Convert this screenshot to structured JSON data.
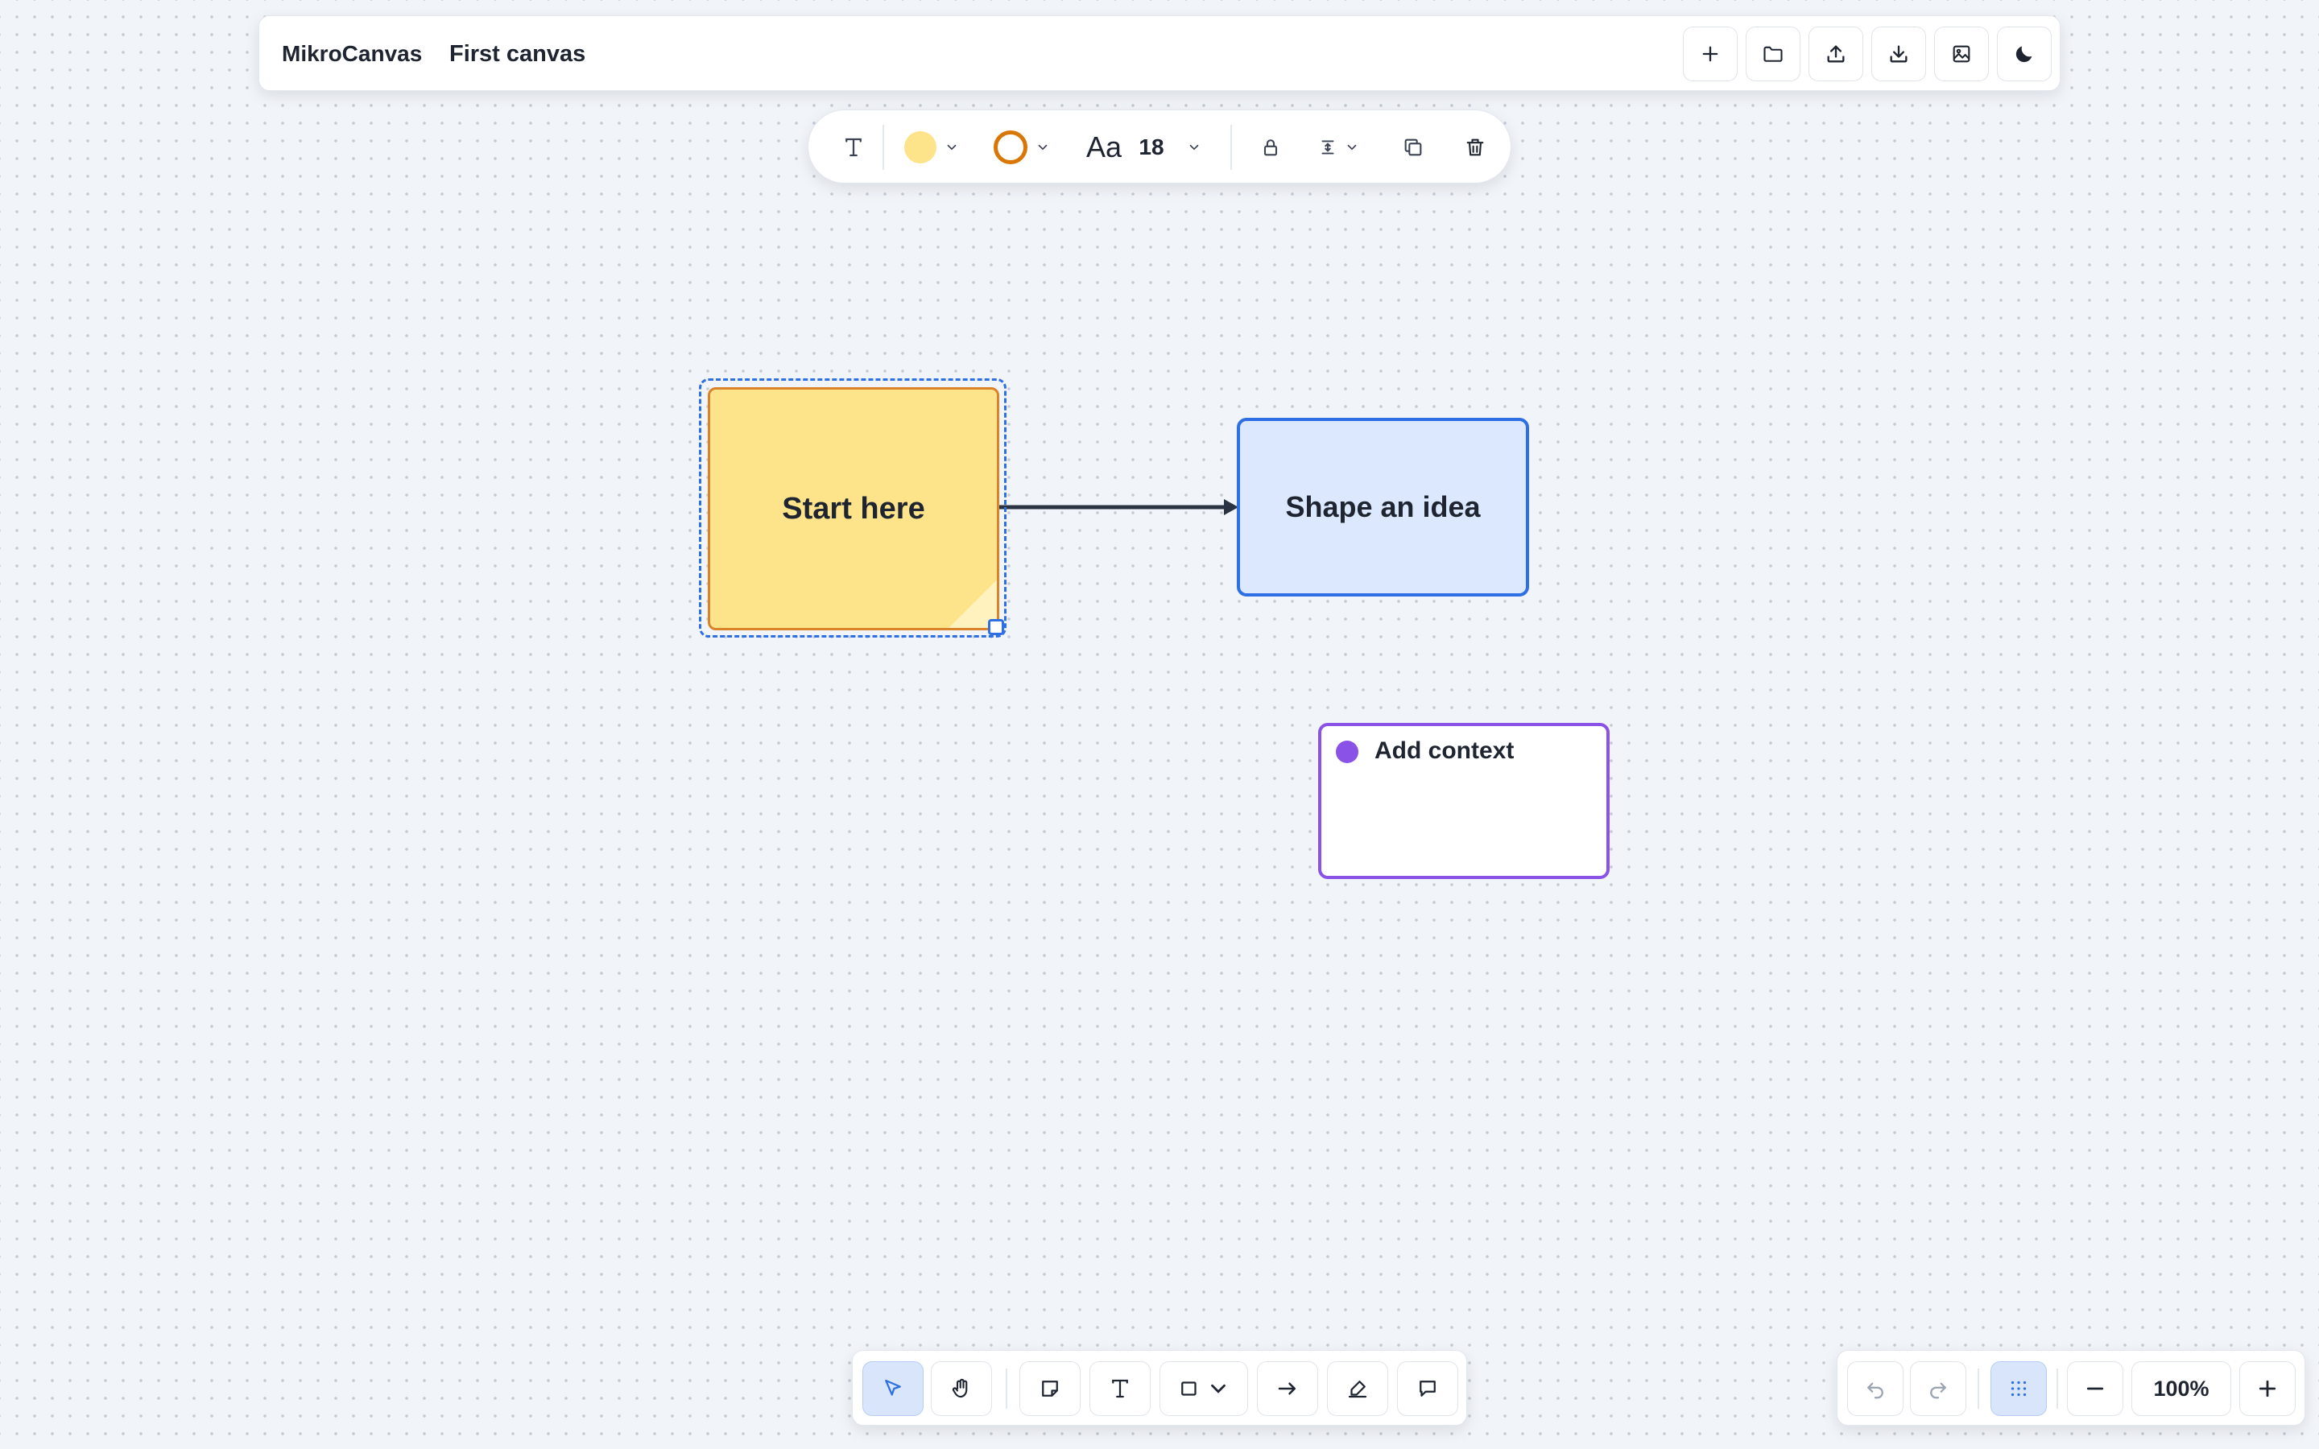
{
  "header": {
    "app_name": "MikroCanvas",
    "canvas_name": "First canvas",
    "buttons": [
      "new-canvas",
      "open-folder",
      "upload",
      "download",
      "export-image",
      "dark-mode"
    ]
  },
  "format_bar": {
    "text_tool": "text-style",
    "fill_color": "#fde38a",
    "stroke_color": "#d97706",
    "font_label": "Aa",
    "font_size": "18"
  },
  "canvas": {
    "sticky_note": {
      "text": "Start here",
      "fill": "#fde38a",
      "stroke": "#d9832a",
      "selected": true
    },
    "shape": {
      "text": "Shape an idea",
      "fill": "#dbe8fd",
      "stroke": "#2f6fe4"
    },
    "connector": {
      "from": "sticky_note",
      "to": "shape",
      "color": "#2a3342"
    },
    "comment": {
      "text": "Add context",
      "accent": "#8b52e8"
    }
  },
  "toolbar": {
    "tools": [
      "select",
      "hand",
      "sticky-note",
      "text",
      "shape",
      "arrow",
      "pen",
      "comment"
    ],
    "active_tool": "select"
  },
  "zoom": {
    "value": "100%",
    "grid_enabled": true
  },
  "colors": {
    "accent": "#2f6fe4",
    "background": "#f1f4f8"
  }
}
